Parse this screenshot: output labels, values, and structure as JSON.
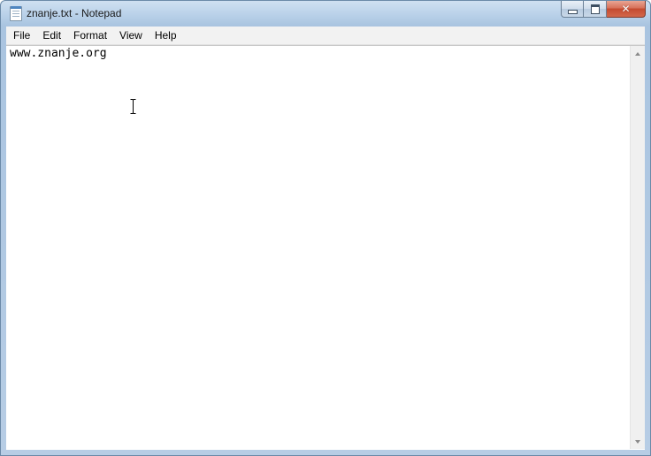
{
  "window": {
    "title": "znanje.txt - Notepad",
    "app_icon": "notepad-document-icon",
    "caption": {
      "minimize_icon": "minimize-icon",
      "maximize_icon": "maximize-icon",
      "close_symbol": "✕"
    }
  },
  "menubar": {
    "items": [
      {
        "label": "File"
      },
      {
        "label": "Edit"
      },
      {
        "label": "Format"
      },
      {
        "label": "View"
      },
      {
        "label": "Help"
      }
    ]
  },
  "editor": {
    "content": "www.znanje.org"
  },
  "scrollbar": {
    "up_icon": "scroll-up-arrow-icon",
    "down_icon": "scroll-down-arrow-icon"
  },
  "colors": {
    "frame": "#b7cde5",
    "close_button": "#c44a2f",
    "menubar": "#f2f2f2"
  }
}
